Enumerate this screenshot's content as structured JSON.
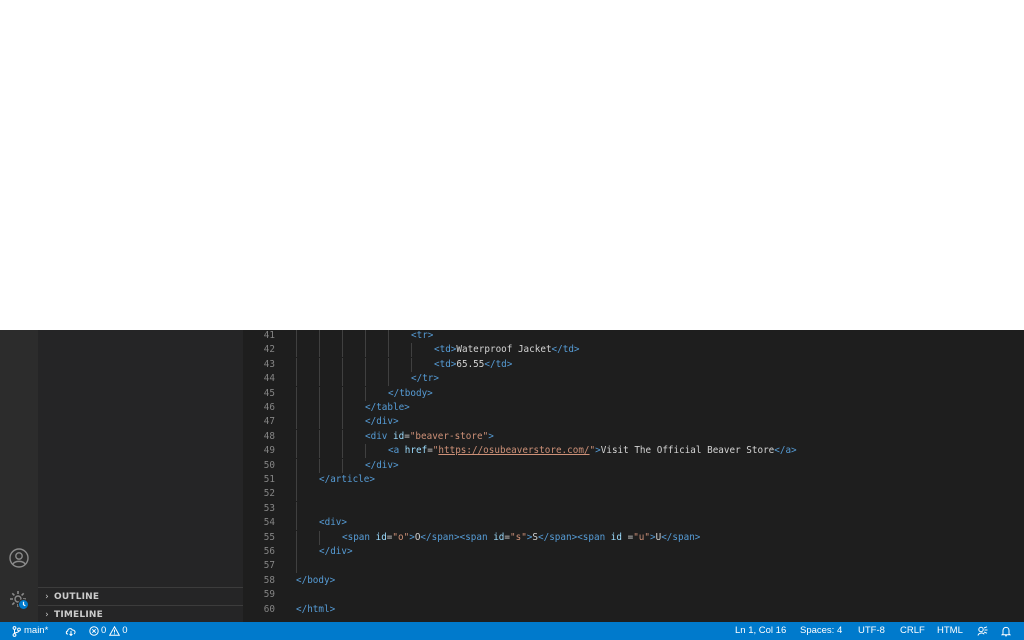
{
  "sidebar": {
    "sections": [
      {
        "label": "OUTLINE"
      },
      {
        "label": "TIMELINE"
      }
    ]
  },
  "editor": {
    "lines": [
      {
        "n": "41",
        "indent": 5,
        "parts": [
          {
            "t": "tag",
            "v": "<tr>"
          }
        ]
      },
      {
        "n": "42",
        "indent": 6,
        "parts": [
          {
            "t": "tag",
            "v": "<td>"
          },
          {
            "t": "txt",
            "v": "Waterproof Jacket"
          },
          {
            "t": "tag",
            "v": "</td>"
          }
        ]
      },
      {
        "n": "43",
        "indent": 6,
        "parts": [
          {
            "t": "tag",
            "v": "<td>"
          },
          {
            "t": "txt",
            "v": "65.55"
          },
          {
            "t": "tag",
            "v": "</td>"
          }
        ]
      },
      {
        "n": "44",
        "indent": 5,
        "parts": [
          {
            "t": "tag",
            "v": "</tr>"
          }
        ]
      },
      {
        "n": "45",
        "indent": 4,
        "parts": [
          {
            "t": "tag",
            "v": "</tbody>"
          }
        ]
      },
      {
        "n": "46",
        "indent": 3,
        "parts": [
          {
            "t": "tag",
            "v": "</table>"
          }
        ]
      },
      {
        "n": "47",
        "indent": 3,
        "parts": [
          {
            "t": "tag",
            "v": "</div>"
          }
        ]
      },
      {
        "n": "48",
        "indent": 3,
        "parts": [
          {
            "t": "tag",
            "v": "<div "
          },
          {
            "t": "attr",
            "v": "id"
          },
          {
            "t": "txt",
            "v": "="
          },
          {
            "t": "str",
            "v": "\"beaver-store\""
          },
          {
            "t": "tag",
            "v": ">"
          }
        ]
      },
      {
        "n": "49",
        "indent": 4,
        "parts": [
          {
            "t": "tag",
            "v": "<a "
          },
          {
            "t": "attr",
            "v": "href"
          },
          {
            "t": "txt",
            "v": "="
          },
          {
            "t": "str",
            "v": "\""
          },
          {
            "t": "lnk",
            "v": "https://osubeaverstore.com/"
          },
          {
            "t": "str",
            "v": "\""
          },
          {
            "t": "tag",
            "v": ">"
          },
          {
            "t": "txt",
            "v": "Visit The Official Beaver Store"
          },
          {
            "t": "tag",
            "v": "</a>"
          }
        ]
      },
      {
        "n": "50",
        "indent": 3,
        "parts": [
          {
            "t": "tag",
            "v": "</div>"
          }
        ]
      },
      {
        "n": "51",
        "indent": 1,
        "parts": [
          {
            "t": "tag",
            "v": "</article>"
          }
        ]
      },
      {
        "n": "52",
        "indent": 1,
        "parts": []
      },
      {
        "n": "53",
        "indent": 1,
        "parts": []
      },
      {
        "n": "54",
        "indent": 1,
        "parts": [
          {
            "t": "tag",
            "v": "<div>"
          }
        ]
      },
      {
        "n": "55",
        "indent": 2,
        "parts": [
          {
            "t": "tag",
            "v": "<span "
          },
          {
            "t": "attr",
            "v": "id"
          },
          {
            "t": "txt",
            "v": "="
          },
          {
            "t": "str",
            "v": "\"o\""
          },
          {
            "t": "tag",
            "v": ">"
          },
          {
            "t": "txt",
            "v": "O"
          },
          {
            "t": "tag",
            "v": "</span><span "
          },
          {
            "t": "attr",
            "v": "id"
          },
          {
            "t": "txt",
            "v": "="
          },
          {
            "t": "str",
            "v": "\"s\""
          },
          {
            "t": "tag",
            "v": ">"
          },
          {
            "t": "txt",
            "v": "S"
          },
          {
            "t": "tag",
            "v": "</span><span "
          },
          {
            "t": "attr",
            "v": "id"
          },
          {
            "t": "txt",
            "v": " ="
          },
          {
            "t": "str",
            "v": "\"u\""
          },
          {
            "t": "tag",
            "v": ">"
          },
          {
            "t": "txt",
            "v": "U"
          },
          {
            "t": "tag",
            "v": "</span>"
          }
        ]
      },
      {
        "n": "56",
        "indent": 1,
        "parts": [
          {
            "t": "tag",
            "v": "</div>"
          }
        ]
      },
      {
        "n": "57",
        "indent": 1,
        "parts": []
      },
      {
        "n": "58",
        "indent": 0,
        "parts": [
          {
            "t": "tag",
            "v": "</body>"
          }
        ]
      },
      {
        "n": "59",
        "indent": 0,
        "parts": []
      },
      {
        "n": "60",
        "indent": 0,
        "parts": [
          {
            "t": "tag",
            "v": "</html>"
          }
        ]
      }
    ]
  },
  "status_bar": {
    "branch": "main*",
    "errors": "0",
    "warnings": "0",
    "cursor": "Ln 1, Col 16",
    "spaces": "Spaces: 4",
    "encoding": "UTF-8",
    "eol": "CRLF",
    "language": "HTML"
  },
  "icons": {
    "branch": "source-control-branch-icon",
    "sync": "cloud-sync-icon",
    "error": "error-circle-icon",
    "warning": "warning-triangle-icon",
    "account": "account-icon",
    "settings": "manage-gear-icon",
    "feedback": "feedback-icon",
    "notifications": "bell-icon"
  },
  "colors": {
    "status_bar": "#007acc",
    "editor_bg": "#1e1e1e",
    "sidebar_bg": "#252526",
    "activity_bar_bg": "#2c2c2c",
    "tag": "#569cd6",
    "attribute": "#9cdcfe",
    "string": "#ce9178",
    "text": "#d4d4d4"
  }
}
